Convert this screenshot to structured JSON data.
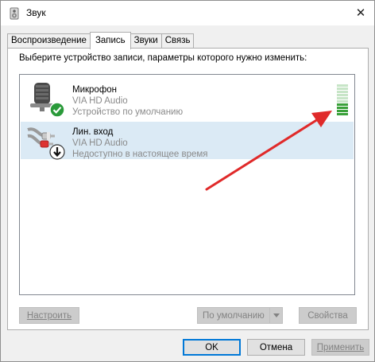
{
  "window": {
    "title": "Звук",
    "close_label": "✕"
  },
  "tabs": [
    {
      "label": "Воспроизведение",
      "active": false
    },
    {
      "label": "Запись",
      "active": true
    },
    {
      "label": "Звуки",
      "active": false
    },
    {
      "label": "Связь",
      "active": false
    }
  ],
  "panel": {
    "instruction": "Выберите устройство записи, параметры которого нужно изменить:"
  },
  "devices": [
    {
      "name": "Микрофон",
      "driver": "VIA HD Audio",
      "status": "Устройство по умолчанию",
      "icon": "microphone-icon",
      "badge": "default-check-icon",
      "selected": false,
      "level_segments_lit": 4,
      "level_segments_total": 10
    },
    {
      "name": "Лин. вход",
      "driver": "VIA HD Audio",
      "status": "Недоступно в настоящее время",
      "icon": "line-in-cable-icon",
      "badge": "unavailable-down-arrow-icon",
      "selected": true
    }
  ],
  "panel_buttons": {
    "configure": "Настроить",
    "set_default": "По умолчанию",
    "properties": "Свойства"
  },
  "dialog_buttons": {
    "ok": "OK",
    "cancel": "Отмена",
    "apply": "Применить"
  },
  "colors": {
    "selection": "#dbeaf5",
    "level_lit": "#3aa13a",
    "level_unlit": "#c7e5c7",
    "check_badge": "#2a9a3a",
    "annotation_arrow": "#e02a2a"
  }
}
